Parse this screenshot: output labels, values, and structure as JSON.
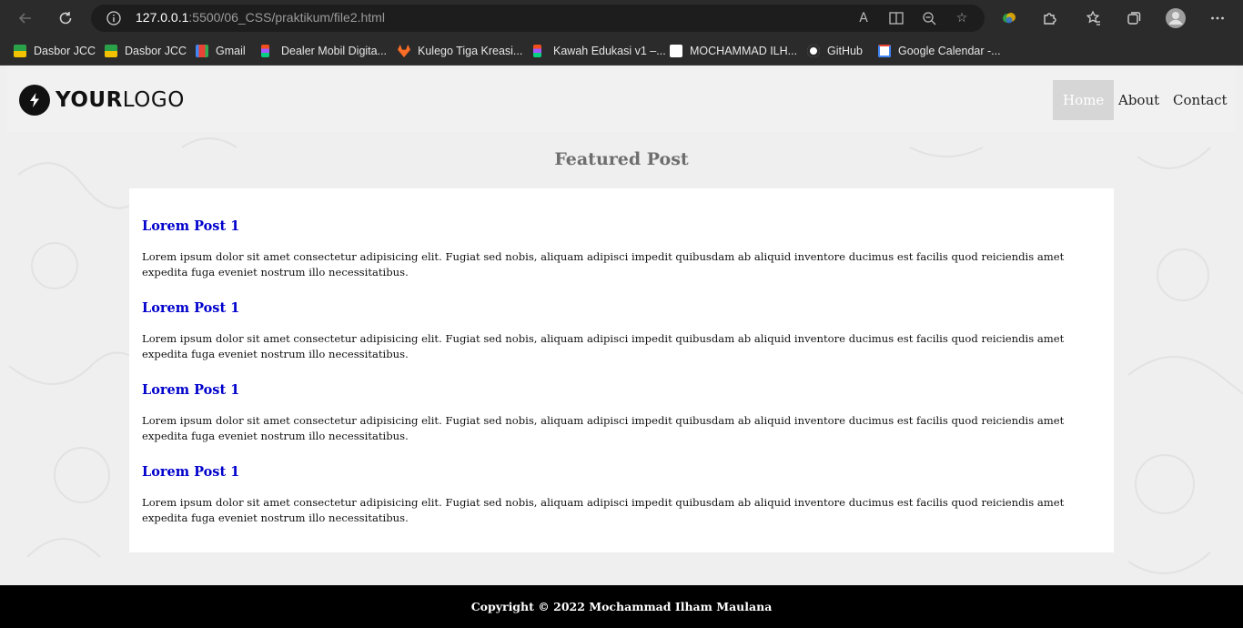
{
  "browser": {
    "url_host": "127.0.0.1",
    "url_rest": ":5500/06_CSS/praktikum/file2.html",
    "icons": [
      "back-icon",
      "refresh-icon",
      "site-info-icon",
      "read-aloud-icon",
      "immersive-reader-icon",
      "zoom-out-icon",
      "favorite-add-icon",
      "copilot-icon",
      "extensions-icon",
      "favorites-icon",
      "collections-icon",
      "profile-icon",
      "more-icon"
    ]
  },
  "bookmarks": [
    {
      "label": "Dasbor JCC",
      "icon": "jcc-icon",
      "color": "#2aa24a"
    },
    {
      "label": "Dasbor JCC",
      "icon": "jcc-icon",
      "color": "#2aa24a"
    },
    {
      "label": "Gmail",
      "icon": "gmail-icon",
      "color": "#ea4335"
    },
    {
      "label": "Dealer Mobil Digita...",
      "icon": "figma-icon",
      "color": "#f24e1e"
    },
    {
      "label": "Kulego Tiga Kreasi...",
      "icon": "gitlab-icon",
      "color": "#fc6d26"
    },
    {
      "label": "Kawah Edukasi v1 –...",
      "icon": "figma-icon",
      "color": "#f24e1e"
    },
    {
      "label": "MOCHAMMAD ILH...",
      "icon": "doc-icon",
      "color": "#ffffff"
    },
    {
      "label": "GitHub",
      "icon": "github-icon",
      "color": "#ffffff"
    },
    {
      "label": "Google Calendar -...",
      "icon": "calendar-icon",
      "color": "#4285f4"
    }
  ],
  "site": {
    "logo": {
      "bold": "YOUR",
      "light": "LOGO"
    },
    "nav": [
      {
        "label": "Home",
        "active": true
      },
      {
        "label": "About",
        "active": false
      },
      {
        "label": "Contact",
        "active": false
      }
    ],
    "section_title": "Featured Post",
    "posts": [
      {
        "title": "Lorem Post 1",
        "body": "Lorem ipsum dolor sit amet consectetur adipisicing elit. Fugiat sed nobis, aliquam adipisci impedit quibusdam ab aliquid inventore ducimus est facilis quod reiciendis amet expedita fuga eveniet nostrum illo necessitatibus."
      },
      {
        "title": "Lorem Post 1",
        "body": "Lorem ipsum dolor sit amet consectetur adipisicing elit. Fugiat sed nobis, aliquam adipisci impedit quibusdam ab aliquid inventore ducimus est facilis quod reiciendis amet expedita fuga eveniet nostrum illo necessitatibus."
      },
      {
        "title": "Lorem Post 1",
        "body": "Lorem ipsum dolor sit amet consectetur adipisicing elit. Fugiat sed nobis, aliquam adipisci impedit quibusdam ab aliquid inventore ducimus est facilis quod reiciendis amet expedita fuga eveniet nostrum illo necessitatibus."
      },
      {
        "title": "Lorem Post 1",
        "body": "Lorem ipsum dolor sit amet consectetur adipisicing elit. Fugiat sed nobis, aliquam adipisci impedit quibusdam ab aliquid inventore ducimus est facilis quod reiciendis amet expedita fuga eveniet nostrum illo necessitatibus."
      }
    ],
    "footer": "Copyright © 2022 Mochammad Ilham Maulana"
  },
  "colors": {
    "post_title": "#0000cc",
    "nav_active_bg": "#d6d6d6",
    "footer_bg": "#000000"
  }
}
